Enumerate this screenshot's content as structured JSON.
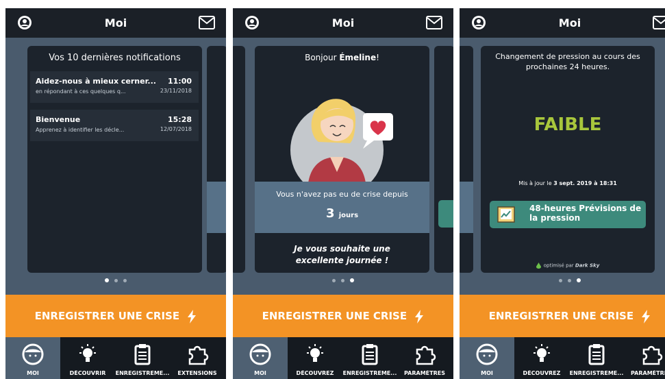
{
  "header": {
    "title": "Moi"
  },
  "screen1": {
    "card_title": "Vos 10 dernières notifications",
    "notifications": [
      {
        "title": "Aidez-nous à mieux cerner...",
        "subtitle": "en répondant à ces quelques q...",
        "time": "11:00",
        "date": "23/11/2018"
      },
      {
        "title": "Bienvenue",
        "subtitle": "Apprenez à identifier les décle...",
        "time": "15:28",
        "date": "12/07/2018"
      }
    ],
    "peek_lines": [
      "0",
      "3",
      "3",
      "3"
    ]
  },
  "screen2": {
    "greeting_prefix": "Bonjour ",
    "greeting_name": "Émeline",
    "greeting_suffix": "!",
    "no_crisis_text": "Vous n'avez pas eu de crise depuis",
    "days_value": "3",
    "days_unit": "jours",
    "wish_line1": "Je vous souhaite une",
    "wish_line2": "excellente journée !",
    "peek_letter": "C"
  },
  "screen3": {
    "pressure_text": "Changement de pression au cours des prochaines 24 heures.",
    "level": "FAIBLE",
    "updated_prefix": "Mis à jour le ",
    "updated_value": "3 sept. 2019 à 18:31",
    "forecast_line1": "48-heures Prévisions de",
    "forecast_line2": "la pression",
    "powered_prefix": "optimisé par ",
    "powered_name": "Dark Sky"
  },
  "cta": {
    "label": "ENREGISTRER UNE CRISE"
  },
  "tabs": {
    "s1": [
      "MOI",
      "DÉCOUVRIR",
      "ENREGISTREME...",
      "EXTENSIONS"
    ],
    "s2": [
      "MOI",
      "DÉCOUVREZ",
      "ENREGISTREME...",
      "PARAMÈTRES"
    ],
    "s3": [
      "MOI",
      "DÉCOUVREZ",
      "ENREGISTREME...",
      "PARAMÈTRES"
    ]
  },
  "pager": {
    "s1_active": 1,
    "s2_active": 3,
    "s3_active": 3,
    "count": 3
  },
  "colors": {
    "accent": "#f39325",
    "level": "#a8c63c",
    "forecast": "#3d8a7c",
    "band": "#577188"
  },
  "icons": [
    "settings-icon",
    "mail-icon",
    "bolt-icon",
    "face-icon",
    "bulb-icon",
    "clipboard-icon",
    "puzzle-icon",
    "chart-book-icon",
    "dark-sky-icon"
  ]
}
